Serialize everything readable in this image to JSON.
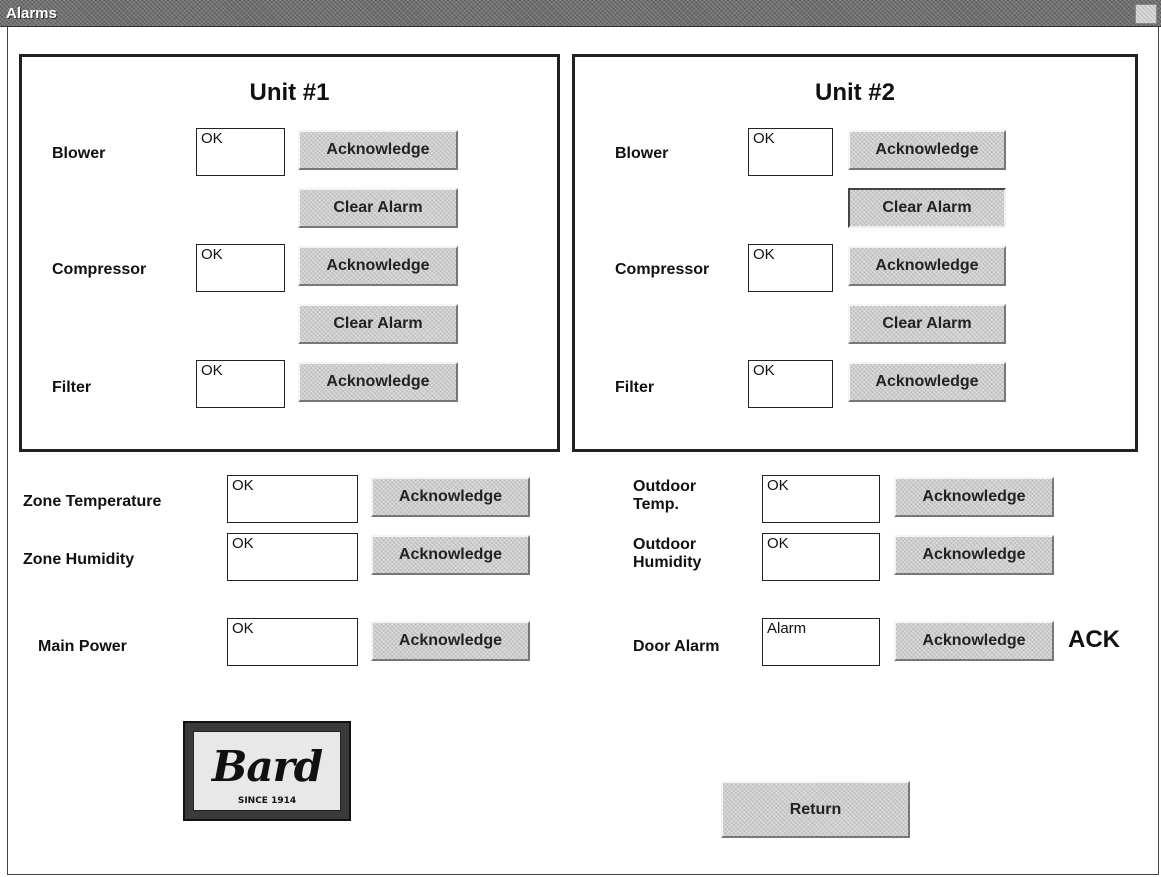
{
  "window": {
    "title": "Alarms"
  },
  "unit1": {
    "title": "Unit #1",
    "blower": {
      "label": "Blower",
      "value": "OK",
      "ack": "Acknowledge",
      "clear": "Clear Alarm"
    },
    "compressor": {
      "label": "Compressor",
      "value": "OK",
      "ack": "Acknowledge",
      "clear": "Clear Alarm"
    },
    "filter": {
      "label": "Filter",
      "value": "OK",
      "ack": "Acknowledge"
    }
  },
  "unit2": {
    "title": "Unit #2",
    "blower": {
      "label": "Blower",
      "value": "OK",
      "ack": "Acknowledge",
      "clear": "Clear Alarm"
    },
    "compressor": {
      "label": "Compressor",
      "value": "OK",
      "ack": "Acknowledge",
      "clear": "Clear Alarm"
    },
    "filter": {
      "label": "Filter",
      "value": "OK",
      "ack": "Acknowledge"
    }
  },
  "zone_temperature": {
    "label": "Zone Temperature",
    "value": "OK",
    "ack": "Acknowledge"
  },
  "zone_humidity": {
    "label": "Zone Humidity",
    "value": "OK",
    "ack": "Acknowledge"
  },
  "main_power": {
    "label": "Main Power",
    "value": "OK",
    "ack": "Acknowledge"
  },
  "outdoor_temp": {
    "label_line1": "Outdoor",
    "label_line2": "Temp.",
    "value": "OK",
    "ack": "Acknowledge"
  },
  "outdoor_humidity": {
    "label_line1": "Outdoor",
    "label_line2": "Humidity",
    "value": "OK",
    "ack": "Acknowledge"
  },
  "door_alarm": {
    "label": "Door Alarm",
    "value": "Alarm",
    "ack": "Acknowledge",
    "status": "ACK"
  },
  "logo": {
    "script": "Bard",
    "since": "SINCE 1914"
  },
  "return_button": "Return"
}
